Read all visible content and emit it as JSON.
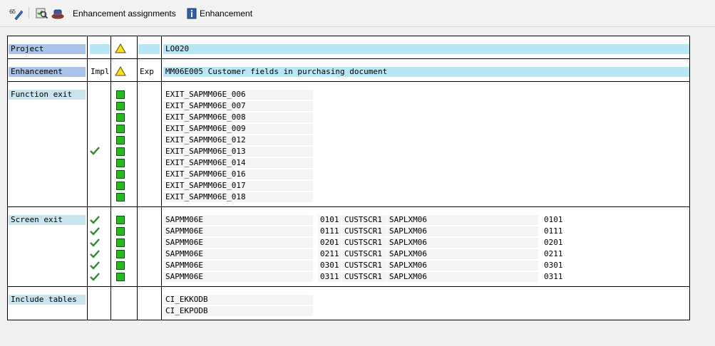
{
  "toolbar": {
    "enhancement_assignments_label": "Enhancement assignments",
    "enhancement_label": "Enhancement"
  },
  "project": {
    "label": "Project",
    "value": "LO020"
  },
  "enhancement": {
    "label": "Enhancement",
    "impl_header": "Impl",
    "exp_header": "Exp",
    "value": "MM06E005 Customer fields in purchasing document"
  },
  "function_exit": {
    "label": "Function exit",
    "items": [
      "EXIT_SAPMM06E_006",
      "EXIT_SAPMM06E_007",
      "EXIT_SAPMM06E_008",
      "EXIT_SAPMM06E_009",
      "EXIT_SAPMM06E_012",
      "EXIT_SAPMM06E_013",
      "EXIT_SAPMM06E_014",
      "EXIT_SAPMM06E_016",
      "EXIT_SAPMM06E_017",
      "EXIT_SAPMM06E_018"
    ]
  },
  "screen_exit": {
    "label": "Screen exit",
    "rows": [
      {
        "program": "SAPMM06E",
        "screen": "0101",
        "area": "CUSTSCR1",
        "called_program": "SAPLXM06",
        "called_screen": "0101"
      },
      {
        "program": "SAPMM06E",
        "screen": "0111",
        "area": "CUSTSCR1",
        "called_program": "SAPLXM06",
        "called_screen": "0111"
      },
      {
        "program": "SAPMM06E",
        "screen": "0201",
        "area": "CUSTSCR1",
        "called_program": "SAPLXM06",
        "called_screen": "0201"
      },
      {
        "program": "SAPMM06E",
        "screen": "0211",
        "area": "CUSTSCR1",
        "called_program": "SAPLXM06",
        "called_screen": "0211"
      },
      {
        "program": "SAPMM06E",
        "screen": "0301",
        "area": "CUSTSCR1",
        "called_program": "SAPLXM06",
        "called_screen": "0301"
      },
      {
        "program": "SAPMM06E",
        "screen": "0311",
        "area": "CUSTSCR1",
        "called_program": "SAPLXM06",
        "called_screen": "0311"
      }
    ]
  },
  "include_tables": {
    "label": "Include tables",
    "items": [
      "CI_EKKODB",
      "CI_EKPODB"
    ]
  },
  "colors": {
    "status_green": "#22bb22",
    "label_blue": "#a9c4e8",
    "label_teal": "#c9e4ec",
    "row_cyan": "#b7e6f4"
  }
}
